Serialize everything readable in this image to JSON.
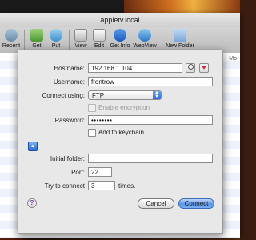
{
  "window": {
    "title": "appletv.local"
  },
  "toolbar": {
    "items": [
      {
        "label": "Recent",
        "icon": "clock-icon"
      },
      {
        "label": "Get",
        "icon": "download-icon"
      },
      {
        "label": "Put",
        "icon": "upload-icon"
      },
      {
        "label": "View",
        "icon": "view-icon"
      },
      {
        "label": "Edit",
        "icon": "edit-icon"
      },
      {
        "label": "Get Info",
        "icon": "info-icon"
      },
      {
        "label": "WebView",
        "icon": "globe-icon"
      },
      {
        "label": "New Folder",
        "icon": "folder-icon"
      }
    ]
  },
  "filelist": {
    "column_header": "Mo"
  },
  "form": {
    "hostname_label": "Hostname:",
    "hostname_value": "192.168.1.104",
    "username_label": "Username:",
    "username_value": "frontrow",
    "connect_using_label": "Connect using:",
    "connect_using_value": "FTP",
    "enable_encryption_label": "Enable encryption",
    "password_label": "Password:",
    "password_value": "••••••••",
    "keychain_label": "Add to keychain",
    "initial_folder_label": "Initial folder:",
    "initial_folder_value": "",
    "port_label": "Port:",
    "port_value": "22",
    "try_label": "Try to connect",
    "try_value": "3",
    "times_label": "times."
  },
  "buttons": {
    "help": "?",
    "cancel": "Cancel",
    "connect": "Connect"
  },
  "colors": {
    "accent": "#5a96e8",
    "favorite": "#d02040"
  }
}
